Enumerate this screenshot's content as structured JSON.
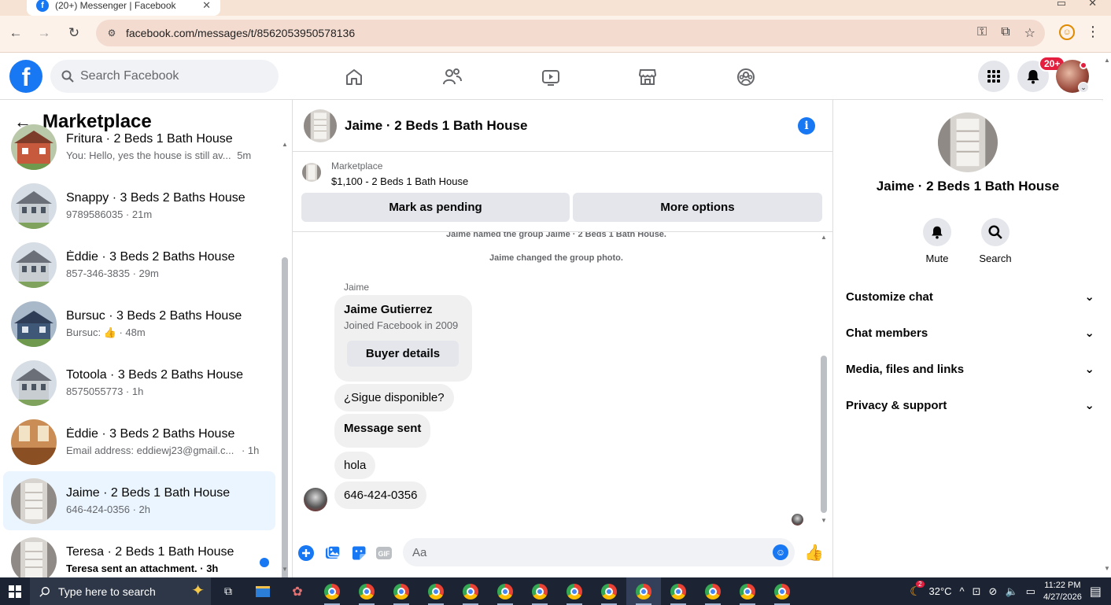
{
  "browser": {
    "tab_title": "(20+) Messenger | Facebook",
    "url": "facebook.com/messages/t/8562053950578136"
  },
  "fb": {
    "search_placeholder": "Search Facebook",
    "notif_badge": "20+"
  },
  "left": {
    "header": "Marketplace",
    "conversations": [
      {
        "title": "Fritura · 2 Beds 1 Bath House",
        "sub": "You: Hello, yes the house is still av...",
        "time": "5m",
        "unread": false
      },
      {
        "title": "Snappy · 3 Beds 2 Baths House",
        "sub": "9789586035 · 21m",
        "time": "",
        "unread": false
      },
      {
        "title": "Èddie · 3 Beds 2 Baths House",
        "sub": "857-346-3835 · 29m",
        "time": "",
        "unread": false
      },
      {
        "title": "Bursuc · 3 Beds 2 Baths House",
        "sub": "Bursuc: 👍 · 48m",
        "time": "",
        "unread": false
      },
      {
        "title": "Totoola · 3 Beds 2 Baths House",
        "sub": "8575055773 · 1h",
        "time": "",
        "unread": false
      },
      {
        "title": "Èddie · 3 Beds 2 Baths House",
        "sub": "Email address: eddiewj23@gmail.c...",
        "time": "· 1h",
        "unread": false
      },
      {
        "title": "Jaime · 2 Beds 1 Bath House",
        "sub": "646-424-0356 · 2h",
        "time": "",
        "unread": false
      },
      {
        "title": "Teresa · 2 Beds 1 Bath House",
        "sub": "Teresa sent an attachment. · 3h",
        "time": "",
        "unread": true
      }
    ]
  },
  "chat": {
    "title": "Jaime · 2 Beds 1 Bath House",
    "marketplace_label": "Marketplace",
    "listing": "$1,100 - 2 Beds 1 Bath House",
    "mark_pending": "Mark as pending",
    "more_options": "More options",
    "system_1": "Jaime named the group Jaime · 2 Beds 1 Bath House.",
    "system_2": "Jaime changed the group photo.",
    "sender": "Jaime",
    "card_name": "Jaime Gutierrez",
    "card_joined": "Joined Facebook in 2009",
    "buyer_details": "Buyer details",
    "messages": [
      "¿Sigue disponible?",
      "Message sent",
      "hola",
      "646-424-0356"
    ],
    "input_placeholder": "Aa"
  },
  "details": {
    "name": "Jaime · 2 Beds 1 Bath House",
    "mute": "Mute",
    "search": "Search",
    "sections": [
      "Customize chat",
      "Chat members",
      "Media, files and links",
      "Privacy & support"
    ]
  },
  "taskbar": {
    "search_placeholder": "Type here to search",
    "weather": "32°C",
    "weather_badge": "2",
    "time": "11:22 PM",
    "date": "4/27/2026"
  },
  "colors": {
    "fb_blue": "#1877f2",
    "active_row": "#ebf5ff",
    "badge_red": "#e41e3f"
  }
}
